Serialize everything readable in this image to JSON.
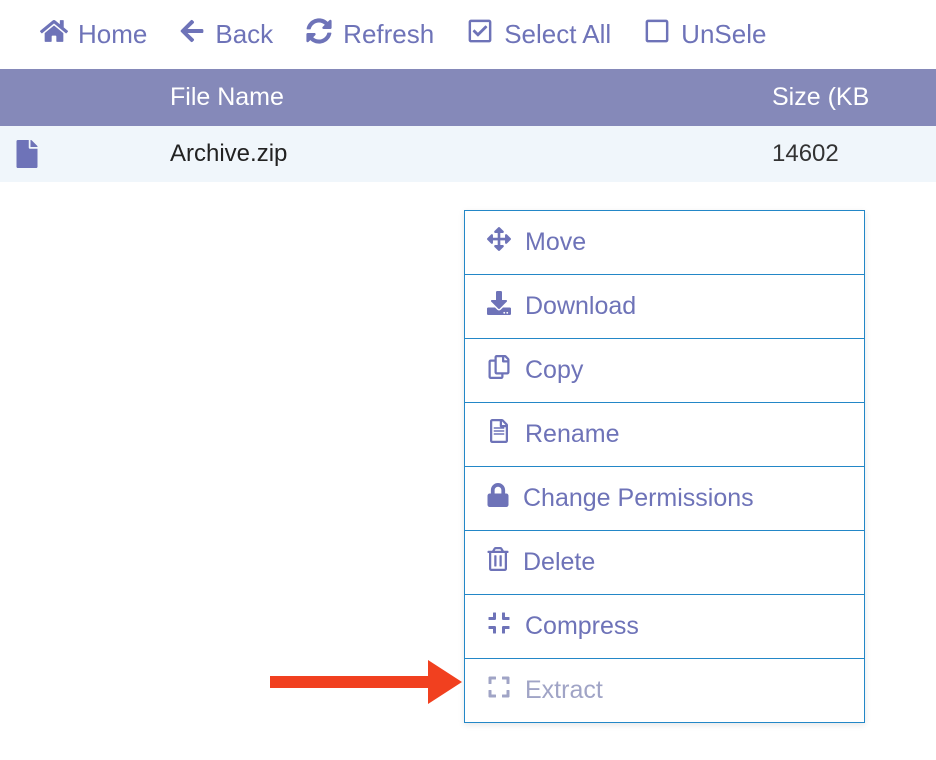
{
  "toolbar": {
    "home": "Home",
    "back": "Back",
    "refresh": "Refresh",
    "select_all": "Select All",
    "unselect": "UnSele"
  },
  "table": {
    "headers": {
      "file_name": "File Name",
      "size": "Size (KB"
    },
    "rows": [
      {
        "name": "Archive.zip",
        "size": "14602"
      }
    ]
  },
  "context_menu": {
    "move": "Move",
    "download": "Download",
    "copy": "Copy",
    "rename": "Rename",
    "permissions": "Change Permissions",
    "delete": "Delete",
    "compress": "Compress",
    "extract": "Extract"
  }
}
